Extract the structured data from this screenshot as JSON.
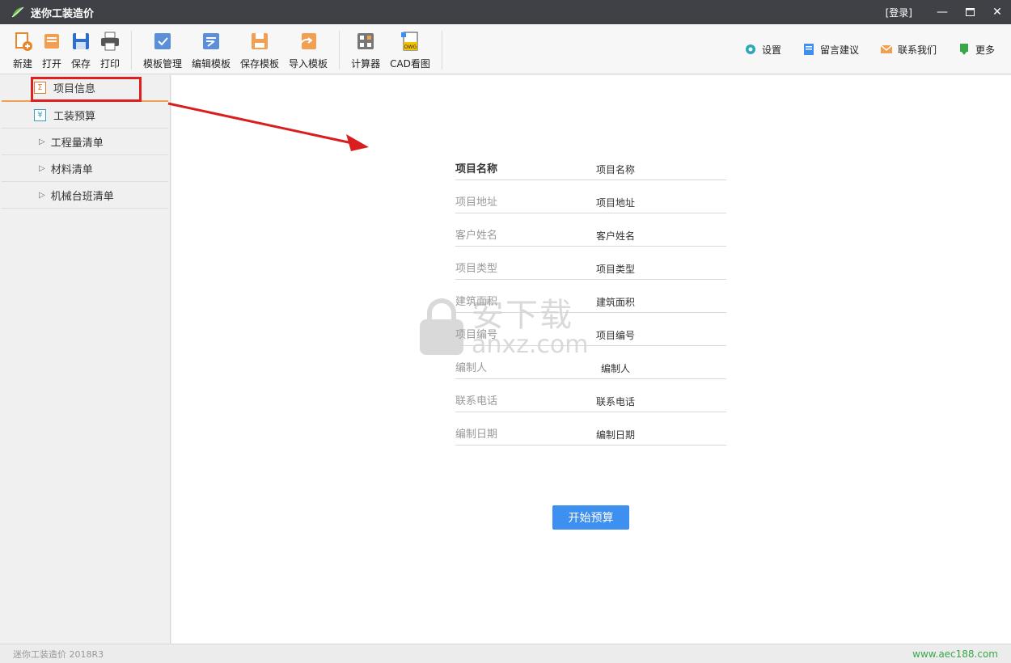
{
  "window": {
    "title": "迷你工装造价",
    "login": "[登录]",
    "minimize": "—",
    "maximize": "□",
    "close": "✕"
  },
  "toolbar": {
    "file_buttons": [
      {
        "label": "新建",
        "icon": "new-file-icon"
      },
      {
        "label": "打开",
        "icon": "open-folder-icon"
      },
      {
        "label": "保存",
        "icon": "save-icon"
      },
      {
        "label": "打印",
        "icon": "print-icon"
      }
    ],
    "template_buttons": [
      {
        "label": "模板管理",
        "icon": "template-manage-icon"
      },
      {
        "label": "编辑模板",
        "icon": "edit-template-icon"
      },
      {
        "label": "保存模板",
        "icon": "save-template-icon"
      },
      {
        "label": "导入模板",
        "icon": "import-template-icon"
      }
    ],
    "tool_buttons": [
      {
        "label": "计算器",
        "icon": "calculator-icon"
      },
      {
        "label": "CAD看图",
        "icon": "dwg-viewer-icon"
      }
    ],
    "right_links": [
      {
        "label": "设置",
        "icon": "gear-icon"
      },
      {
        "label": "留言建议",
        "icon": "feedback-icon"
      },
      {
        "label": "联系我们",
        "icon": "mail-icon"
      },
      {
        "label": "更多",
        "icon": "more-icon"
      }
    ]
  },
  "sidebar": {
    "items": [
      {
        "label": "项目信息",
        "icon": "sigma-icon",
        "glyph": "Σ"
      },
      {
        "label": "工装预算",
        "icon": "yen-icon",
        "glyph": "¥"
      },
      {
        "label": "工程量清单",
        "icon": "expand-triangle-icon",
        "glyph": "▷"
      },
      {
        "label": "材料清单",
        "icon": "expand-triangle-icon",
        "glyph": "▷"
      },
      {
        "label": "机械台班清单",
        "icon": "expand-triangle-icon",
        "glyph": "▷"
      }
    ]
  },
  "form": {
    "fields": [
      {
        "label": "项目名称",
        "value": "项目名称"
      },
      {
        "label": "项目地址",
        "value": "项目地址"
      },
      {
        "label": "客户姓名",
        "value": "客户姓名"
      },
      {
        "label": "项目类型",
        "value": "项目类型"
      },
      {
        "label": "建筑面积",
        "value": "建筑面积"
      },
      {
        "label": "项目编号",
        "value": "项目编号"
      },
      {
        "label": "编制人",
        "value": "编制人"
      },
      {
        "label": "联系电话",
        "value": "联系电话"
      },
      {
        "label": "编制日期",
        "value": "编制日期"
      }
    ],
    "start_button": "开始预算"
  },
  "watermark": {
    "big": "安下载",
    "small": "anxz.com"
  },
  "status": {
    "version": "迷你工装造价 2018R3",
    "website": "www.aec188.com"
  },
  "colors": {
    "titlebar": "#3f4146",
    "accent_blue": "#3d8ff0",
    "highlight_red": "#e02020",
    "active_underline": "#f0a050",
    "site_green": "#3aa84a"
  }
}
